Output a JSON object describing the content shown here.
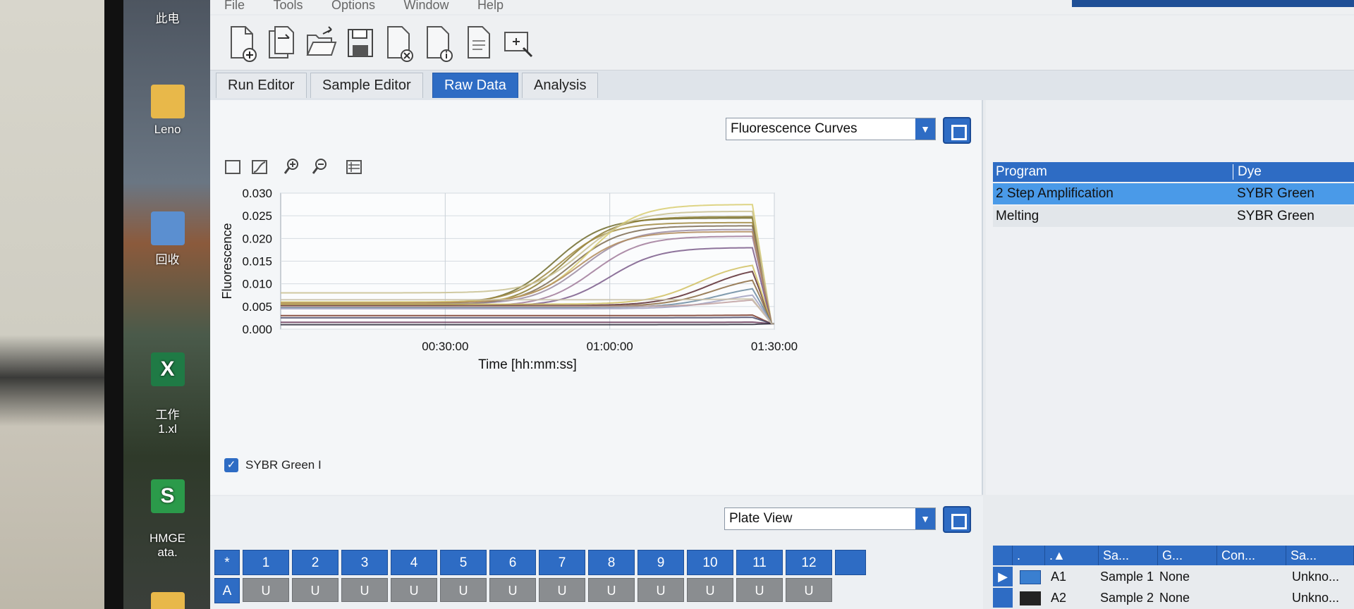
{
  "desktop": {
    "icons": [
      {
        "label": "此电"
      },
      {
        "label": "Leno"
      },
      {
        "label": "回收"
      },
      {
        "label": "工作\n1.xl"
      },
      {
        "label": "HMGE\nata."
      }
    ]
  },
  "menu": {
    "items": [
      "File",
      "Tools",
      "Options",
      "Window",
      "Help"
    ]
  },
  "toolbar": {
    "buttons": [
      "new-file-icon",
      "copy-file-icon",
      "open-folder-icon",
      "save-icon",
      "close-file-icon",
      "file-info-icon",
      "document-icon",
      "zoom-select-icon"
    ]
  },
  "tabs": {
    "items": [
      {
        "label": "Run Editor",
        "active": false
      },
      {
        "label": "Sample Editor",
        "active": false
      },
      {
        "label": "Raw Data",
        "active": true
      },
      {
        "label": "Analysis",
        "active": false
      }
    ]
  },
  "chart_panel": {
    "view_select": "Fluorescence Curves",
    "legend_label": "SYBR Green I",
    "legend_checked": true
  },
  "chart_data": {
    "type": "line",
    "xlabel": "Time [hh:mm:ss]",
    "ylabel": "Fluorescence",
    "x_ticks": [
      "00:30:00",
      "01:00:00",
      "01:30:00"
    ],
    "y_ticks": [
      "0.000",
      "0.005",
      "0.010",
      "0.015",
      "0.020",
      "0.025",
      "0.030"
    ],
    "ylim": [
      0,
      0.03
    ],
    "xlim_minutes": [
      0,
      90
    ],
    "grid": true,
    "legend_position": "bottom-left",
    "series_note": "many overlapping SYBR Green I amplification curves",
    "curves": [
      {
        "baseline": 0.0055,
        "plateau": 0.0245,
        "midpoint": 50,
        "color": "#6f6a2a"
      },
      {
        "baseline": 0.0052,
        "plateau": 0.0248,
        "midpoint": 52,
        "color": "#8a7a30"
      },
      {
        "baseline": 0.0058,
        "plateau": 0.0235,
        "midpoint": 51,
        "color": "#a08840"
      },
      {
        "baseline": 0.0054,
        "plateau": 0.0228,
        "midpoint": 53,
        "color": "#7b6a50"
      },
      {
        "baseline": 0.006,
        "plateau": 0.0275,
        "midpoint": 56,
        "color": "#d8cc70"
      },
      {
        "baseline": 0.008,
        "plateau": 0.026,
        "midpoint": 55,
        "color": "#c8c090"
      },
      {
        "baseline": 0.0055,
        "plateau": 0.022,
        "midpoint": 55,
        "color": "#9a8aa0"
      },
      {
        "baseline": 0.005,
        "plateau": 0.0205,
        "midpoint": 57,
        "color": "#a07a9a"
      },
      {
        "baseline": 0.0058,
        "plateau": 0.0215,
        "midpoint": 54,
        "color": "#b08a5a"
      },
      {
        "baseline": 0.005,
        "plateau": 0.018,
        "midpoint": 60,
        "color": "#7a5a8a"
      },
      {
        "baseline": 0.0052,
        "plateau": 0.014,
        "midpoint": 78,
        "color": "#5a2a30"
      },
      {
        "baseline": 0.0055,
        "plateau": 0.015,
        "midpoint": 76,
        "color": "#d0c060"
      },
      {
        "baseline": 0.005,
        "plateau": 0.012,
        "midpoint": 79,
        "color": "#8a6a40"
      },
      {
        "baseline": 0.0048,
        "plateau": 0.01,
        "midpoint": 80,
        "color": "#6a8aa0"
      },
      {
        "baseline": 0.0045,
        "plateau": 0.0085,
        "midpoint": 81,
        "color": "#a0a0c0"
      },
      {
        "baseline": 0.005,
        "plateau": 0.007,
        "midpoint": 82,
        "color": "#c0a0a0"
      },
      {
        "baseline": 0.003,
        "plateau": 0.0032,
        "midpoint": 85,
        "color": "#7a3a2a"
      },
      {
        "baseline": 0.0025,
        "plateau": 0.0027,
        "midpoint": 85,
        "color": "#4a4a6a"
      },
      {
        "baseline": 0.0015,
        "plateau": 0.0016,
        "midpoint": 85,
        "color": "#6a3a5a"
      },
      {
        "baseline": 0.001,
        "plateau": 0.0011,
        "midpoint": 85,
        "color": "#2a2a3a"
      },
      {
        "baseline": 0.0065,
        "plateau": 0.0068,
        "midpoint": 85,
        "color": "#c8c0a8"
      }
    ]
  },
  "program_panel": {
    "columns": [
      "Program",
      "Dye"
    ],
    "rows": [
      {
        "program": "2 Step Amplification",
        "dye": "SYBR Green",
        "selected": true
      },
      {
        "program": "Melting",
        "dye": "SYBR Green",
        "selected": false
      }
    ]
  },
  "plate_panel": {
    "view_select": "Plate View",
    "corner": "*",
    "columns": [
      "1",
      "2",
      "3",
      "4",
      "5",
      "6",
      "7",
      "8",
      "9",
      "10",
      "11",
      "12"
    ],
    "row_label": "A",
    "row_wells": [
      "U",
      "U",
      "U",
      "U",
      "U",
      "U",
      "U",
      "U",
      "U",
      "U",
      "U",
      "U"
    ]
  },
  "sample_table": {
    "headers": [
      "",
      ".",
      ".▲",
      "Sa...",
      "G...",
      "Con...",
      "Sa..."
    ],
    "rows": [
      {
        "pos": "A1",
        "name": "Sample 1",
        "group": "None",
        "type": "Unkno..."
      },
      {
        "pos": "A2",
        "name": "Sample 2",
        "group": "None",
        "type": "Unkno..."
      }
    ]
  }
}
